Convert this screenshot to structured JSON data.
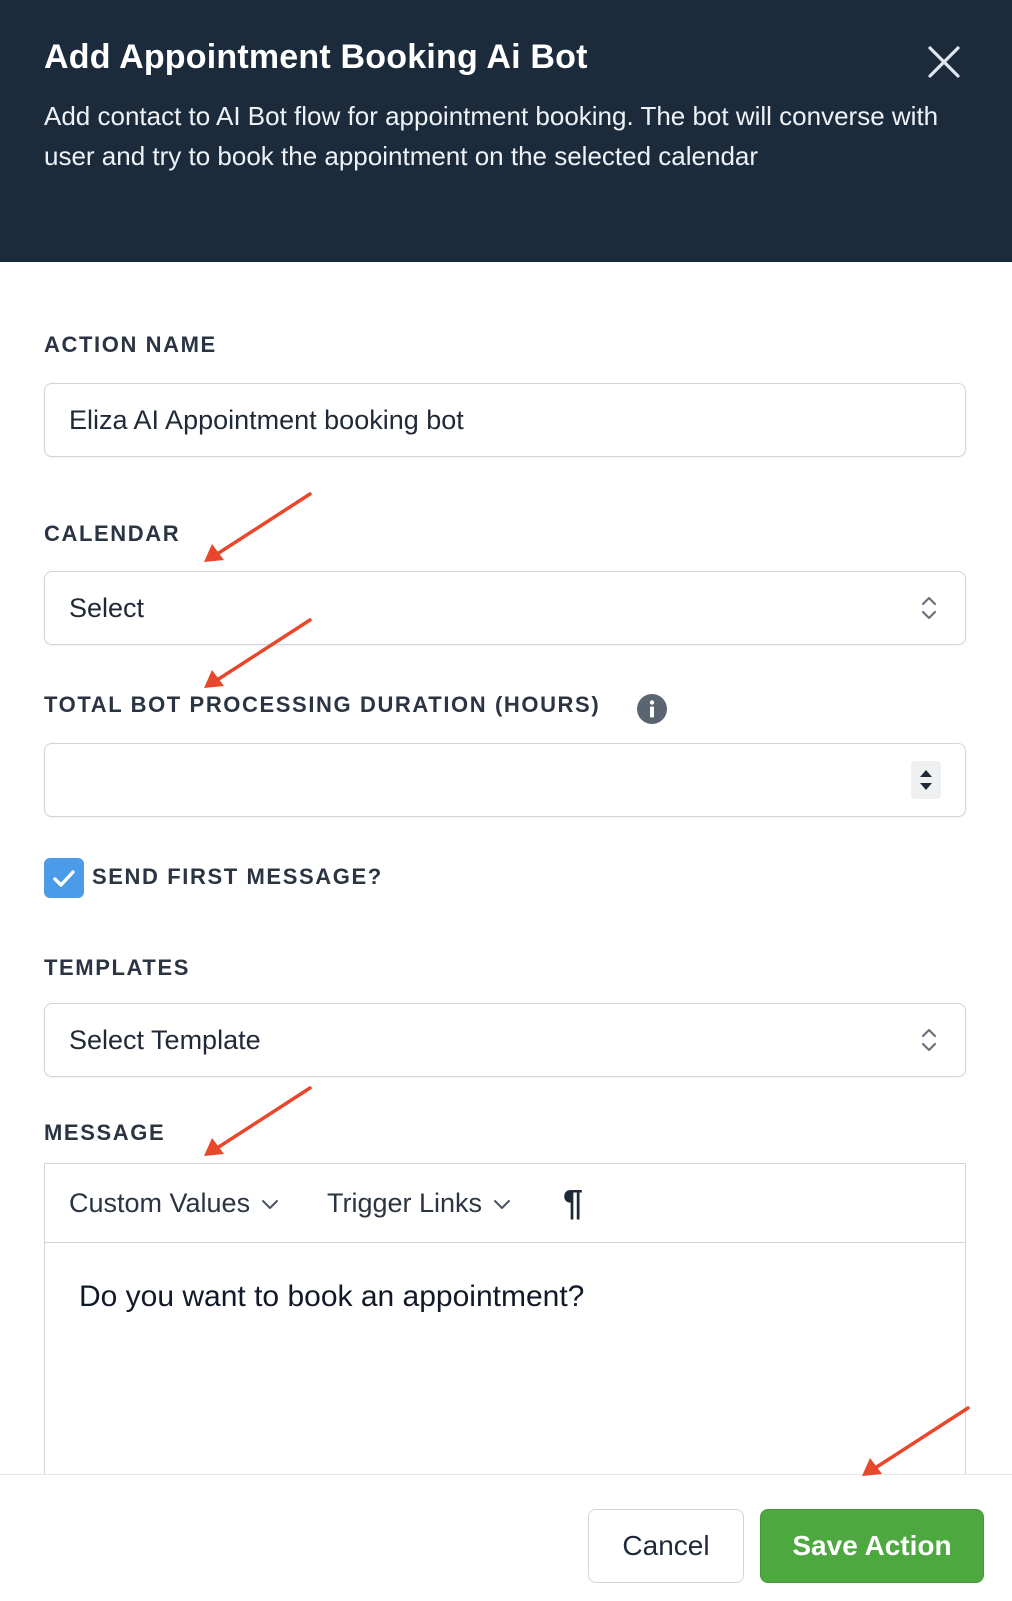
{
  "modal": {
    "title": "Add Appointment Booking Ai Bot",
    "description": "Add contact to AI Bot flow for appointment booking. The bot will converse with user and try to book the appointment on the selected calendar",
    "close_icon": "close-icon"
  },
  "form": {
    "action_name": {
      "label": "ACTION NAME",
      "value": "Eliza AI Appointment booking bot"
    },
    "calendar": {
      "label": "CALENDAR",
      "selected": "Select"
    },
    "duration": {
      "label": "TOTAL BOT PROCESSING DURATION (HOURS)",
      "value": "",
      "info_icon": "info-icon"
    },
    "send_first_message": {
      "label": "SEND FIRST MESSAGE?",
      "checked": true
    },
    "templates": {
      "label": "TEMPLATES",
      "selected": "Select Template"
    },
    "message": {
      "label": "MESSAGE",
      "toolbar": {
        "custom_values": "Custom Values",
        "trigger_links": "Trigger Links",
        "paragraph": "¶"
      },
      "body": "Do you want to book an appointment?"
    }
  },
  "footer": {
    "cancel_label": "Cancel",
    "save_label": "Save Action"
  },
  "colors": {
    "header_bg": "#1b2b3c",
    "primary_green": "#4ea840",
    "checkbox_blue": "#4b9be8",
    "annotation_red": "#e8472b"
  }
}
